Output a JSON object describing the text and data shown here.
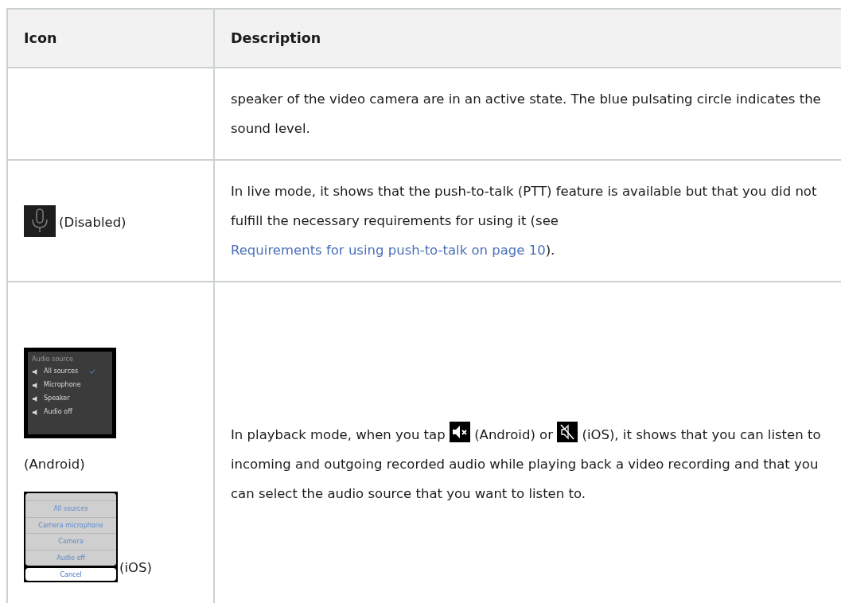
{
  "table": {
    "columns": [
      "Icon",
      "Description"
    ],
    "rows": [
      {
        "description": [
          {
            "kind": "text",
            "text": "speaker of the video camera are in an active state. The blue pulsating circle indicates the sound level."
          }
        ]
      },
      {
        "icon_cell": [
          {
            "kind": "mic-icon",
            "disabled": true
          },
          {
            "kind": "caption",
            "text": "(Disabled)"
          }
        ],
        "description": [
          {
            "kind": "text",
            "text": "In live mode, it shows that the push-to-talk (PTT) feature is available but that you did not fulfill the necessary requirements for using it (see "
          },
          {
            "kind": "link",
            "text": "Requirements for using push-to-talk on page 10"
          },
          {
            "kind": "text",
            "text": ")."
          }
        ]
      },
      {
        "icon_cell": [
          {
            "kind": "android-menu",
            "title": "Audio source",
            "options": [
              {
                "label": "All sources",
                "selected": true
              },
              {
                "label": "Microphone",
                "selected": false
              },
              {
                "label": "Speaker",
                "selected": false
              },
              {
                "label": "Audio off",
                "selected": false
              }
            ]
          },
          {
            "kind": "caption",
            "text": "(Android)"
          },
          {
            "kind": "ios-sheet",
            "options": [
              "All sources",
              "Camera microphone",
              "Camera",
              "Audio off"
            ],
            "cancel": "Cancel"
          },
          {
            "kind": "caption",
            "text": "(iOS)"
          }
        ],
        "description": [
          {
            "kind": "text",
            "text": "In playback mode, when you tap "
          },
          {
            "kind": "icon-x"
          },
          {
            "kind": "text",
            "text": " (Android) or "
          },
          {
            "kind": "icon-slash"
          },
          {
            "kind": "text",
            "text": " (iOS), it shows that you can listen to incoming and outgoing recorded audio while playing back a video recording and that you can select the audio source that you want to listen to."
          }
        ]
      }
    ]
  }
}
